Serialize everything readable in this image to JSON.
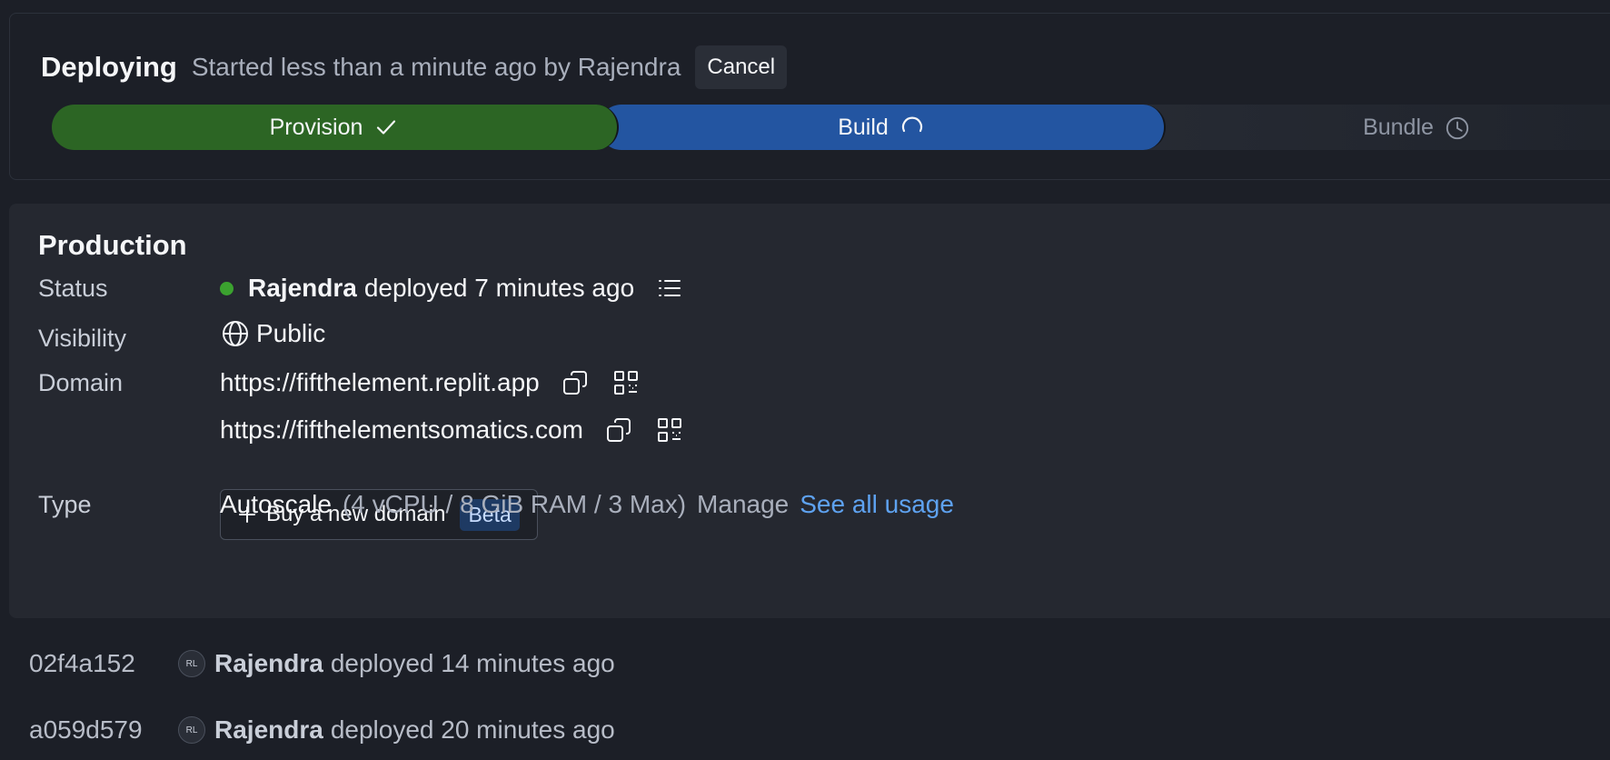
{
  "deploying": {
    "title": "Deploying",
    "subtitle": "Started less than a minute ago by Rajendra",
    "cancel_label": "Cancel",
    "steps": [
      {
        "label": "Provision",
        "state": "done",
        "icon": "check-icon",
        "color": "#2c6524"
      },
      {
        "label": "Build",
        "state": "in-progress",
        "icon": "spinner-icon",
        "color": "#2355a1"
      },
      {
        "label": "Bundle",
        "state": "pending",
        "icon": "clock-icon",
        "color": "#262a33"
      }
    ]
  },
  "production": {
    "title": "Production",
    "status": {
      "label": "Status",
      "user": "Rajendra",
      "text": "deployed 7 minutes ago",
      "dot_color": "#3ba22f"
    },
    "visibility": {
      "label": "Visibility",
      "value": "Public"
    },
    "domain": {
      "label": "Domain",
      "urls": [
        "https://fifthelement.replit.app",
        "https://fifthelementsomatics.com"
      ],
      "buy_label": "Buy a new domain",
      "beta_label": "Beta"
    },
    "type": {
      "label": "Type",
      "value": "Autoscale",
      "spec": "(4 vCPU / 8 GiB RAM / 3 Max)",
      "manage_label": "Manage",
      "usage_label": "See all usage"
    }
  },
  "history": [
    {
      "hash": "02f4a152",
      "avatar": "RL",
      "user": "Rajendra",
      "text": "deployed 14 minutes ago"
    },
    {
      "hash": "a059d579",
      "avatar": "RL",
      "user": "Rajendra",
      "text": "deployed 20 minutes ago"
    }
  ]
}
